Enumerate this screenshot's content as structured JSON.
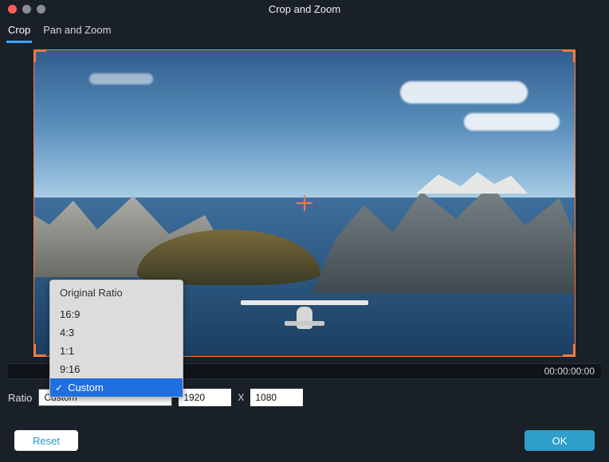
{
  "window": {
    "title": "Crop and Zoom"
  },
  "tabs": [
    {
      "label": "Crop",
      "active": true
    },
    {
      "label": "Pan and Zoom",
      "active": false
    }
  ],
  "timecode": "00:00:00:00",
  "ratio": {
    "label": "Ratio",
    "dropdown_header": "Original Ratio",
    "options": [
      "16:9",
      "4:3",
      "1:1",
      "9:16",
      "Custom"
    ],
    "selected": "Custom"
  },
  "dimensions": {
    "width": "1920",
    "separator": "X",
    "height": "1080"
  },
  "buttons": {
    "reset": "Reset",
    "ok": "OK"
  }
}
